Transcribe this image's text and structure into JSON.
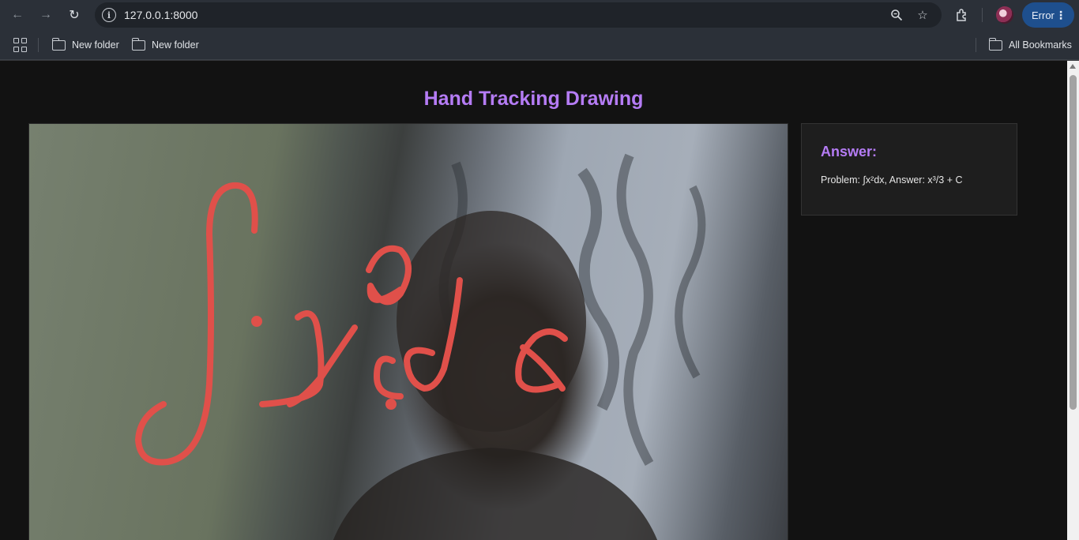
{
  "browser": {
    "url": "127.0.0.1:8000",
    "error_label": "Error",
    "bookmarks": [
      {
        "label": "New folder"
      },
      {
        "label": "New folder"
      }
    ],
    "all_bookmarks_label": "All Bookmarks"
  },
  "page": {
    "title": "Hand Tracking Drawing",
    "answer": {
      "heading": "Answer:",
      "text": "Problem: ∫x²dx, Answer: x³/3 + C"
    }
  },
  "colors": {
    "title": "#b57cf5",
    "drawing_stroke": "#e0504a",
    "error_pill": "#1e4f8d"
  }
}
